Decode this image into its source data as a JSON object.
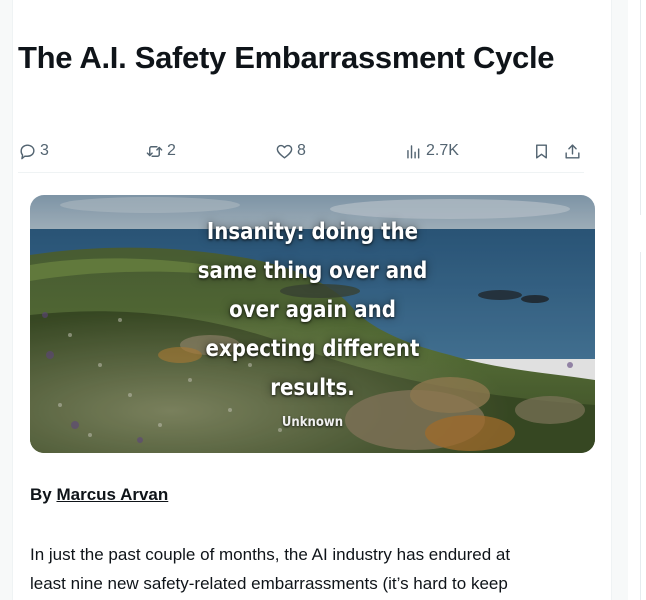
{
  "article": {
    "title": "The A.I. Safety Embarrassment Cycle",
    "byline_prefix": "By",
    "author": "Marcus Arvan",
    "body_lines": [
      "In just the past couple of months, the AI industry has endured at",
      "least nine new safety-related embarrassments (it’s hard to keep"
    ]
  },
  "actions": {
    "replies": "3",
    "reposts": "2",
    "likes": "8",
    "views": "2.7K"
  },
  "icons": {
    "reply": "speech-bubble-icon",
    "repost": "repost-arrows-icon",
    "like": "heart-icon",
    "views": "bar-chart-icon",
    "bookmark": "bookmark-icon",
    "share": "share-upload-icon"
  },
  "media": {
    "quote_lines": [
      "Insanity: doing the",
      "same thing over and",
      "over again and",
      "expecting different",
      "results."
    ],
    "attribution": "Unknown"
  },
  "colors": {
    "text": "#0f1419",
    "secondary": "#536471",
    "divider": "#eff3f4"
  }
}
